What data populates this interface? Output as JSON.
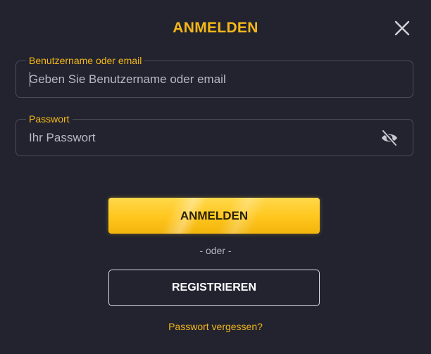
{
  "modal": {
    "title": "ANMELDEN"
  },
  "username_field": {
    "label": "Benutzername oder email",
    "placeholder": "Geben Sie Benutzername oder email"
  },
  "password_field": {
    "label": "Passwort",
    "placeholder": "Ihr Passwort",
    "toggle_icon": "eye-off-icon"
  },
  "actions": {
    "login_label": "ANMELDEN",
    "separator": "- oder -",
    "register_label": "REGISTRIEREN",
    "forgot_label": "Passwort vergessen?"
  },
  "colors": {
    "background": "#22232f",
    "accent": "#f5b818",
    "border": "#4a4c5b"
  }
}
